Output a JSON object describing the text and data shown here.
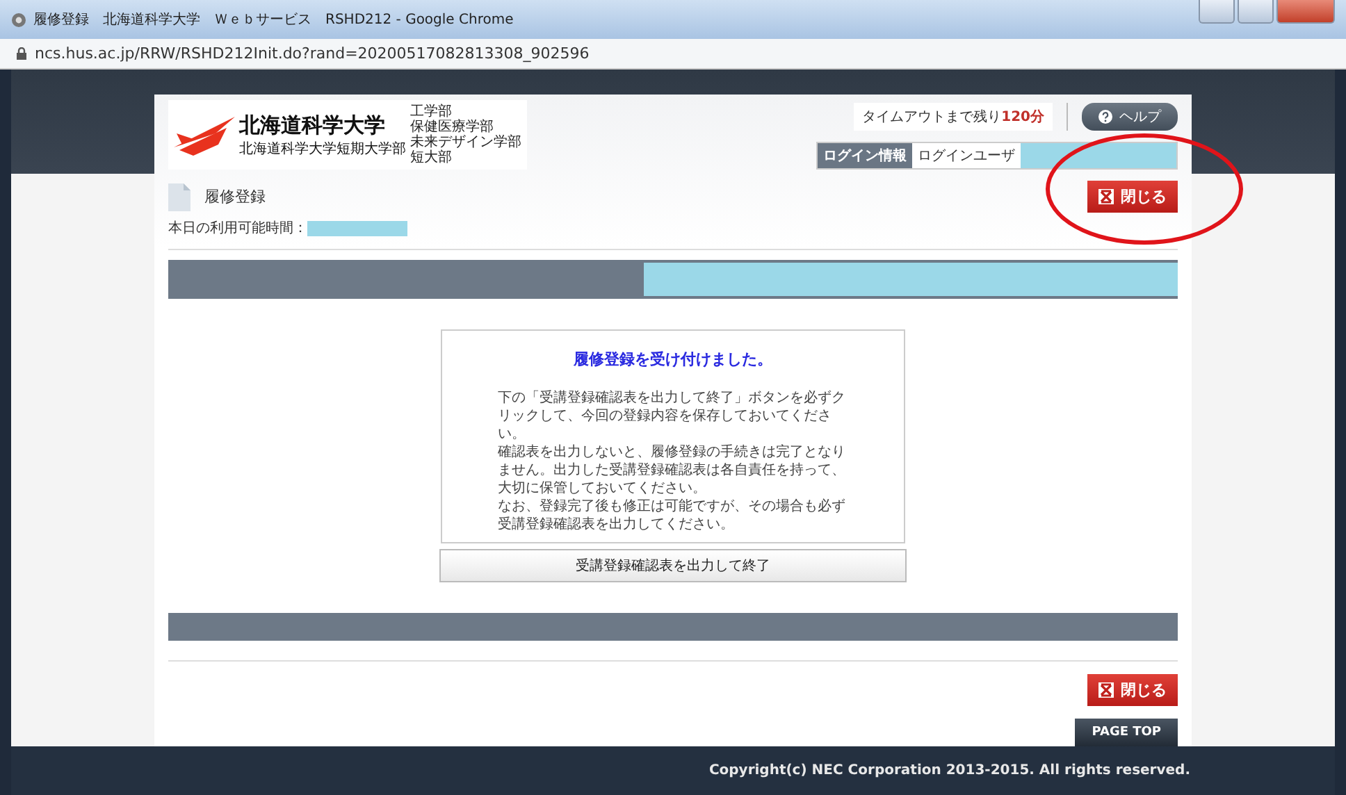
{
  "window": {
    "title": "履修登録　北海道科学大学　Ｗｅｂサービス　RSHD212 - Google Chrome"
  },
  "address_bar": {
    "url": "ncs.hus.ac.jp/RRW/RSHD212Init.do?rand=20200517082813308_902596"
  },
  "logo": {
    "name": "北海道科学大学",
    "subname": "北海道科学大学短期大学部",
    "faculties": [
      "工学部",
      "保健医療学部",
      "未来デザイン学部",
      "短大部"
    ]
  },
  "timeout": {
    "label": "タイムアウトまで残り",
    "value": "120分"
  },
  "help_button": {
    "label": "ヘルプ"
  },
  "login_info": {
    "heading": "ログイン情報",
    "label": "ログインユーザ"
  },
  "page_title": "履修登録",
  "close_buttons": [
    "閉じる",
    "閉じる"
  ],
  "available_time": {
    "label": "本日の利用可能時間："
  },
  "message": {
    "title": "履修登録を受け付けました。",
    "paragraphs": [
      "下の「受講登録確認表を出力して終了」ボタンを必ずクリックして、今回の登録内容を保存しておいてください。",
      "確認表を出力しないと、履修登録の手続きは完了となりません。出力した受講登録確認表は各自責任を持って、大切に保管しておいてください。",
      "なお、登録完了後も修正は可能ですが、その場合も必ず受講登録確認表を出力してください。"
    ]
  },
  "output_button": "受講登録確認表を出力して終了",
  "page_top": "PAGE TOP",
  "footer": "Copyright(c) NEC Corporation 2013-2015. All rights reserved."
}
